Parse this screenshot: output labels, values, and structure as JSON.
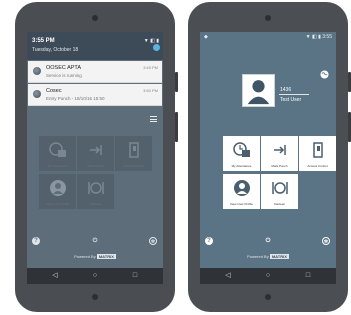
{
  "left_phone": {
    "shade": {
      "time": "3:55 PM",
      "date": "Tuesday, October 18",
      "status_icons": "▼ ◧ ▮"
    },
    "notifications": [
      {
        "title": "OOSEC APTA",
        "subtitle": "Service is running",
        "time": "3:45 PM"
      },
      {
        "title": "Cosec",
        "subtitle": "Entry Punch - 18/10/16 15:50",
        "time": "3:50 PM"
      }
    ],
    "tiles": [
      {
        "label": "My Attendance",
        "icon": "attendance-icon"
      },
      {
        "label": "Mark Punch",
        "icon": "punch-icon"
      },
      {
        "label": "Access Control",
        "icon": "door-icon"
      },
      {
        "label": "View User Profile",
        "icon": "user-profile-icon"
      },
      {
        "label": "Canteen",
        "icon": "canteen-icon"
      }
    ],
    "powered_by": "Powered By",
    "brand": "MATRIX"
  },
  "right_phone": {
    "status_time": "3:55",
    "status_icons": "▼ ◧ ▮",
    "user": {
      "id": "1436",
      "name": "Test User"
    },
    "tiles": [
      {
        "label": "My Attendance",
        "icon": "attendance-icon"
      },
      {
        "label": "Mark Punch",
        "icon": "punch-icon"
      },
      {
        "label": "Access Control",
        "icon": "door-icon"
      },
      {
        "label": "View User Profile",
        "icon": "user-profile-icon"
      },
      {
        "label": "Canteen",
        "icon": "canteen-icon"
      }
    ],
    "powered_by": "Powered By",
    "brand": "MATRIX"
  },
  "colors": {
    "screen_left": "#5d6d7a",
    "screen_right": "#5a7385",
    "accent": "#5ab4e0"
  }
}
